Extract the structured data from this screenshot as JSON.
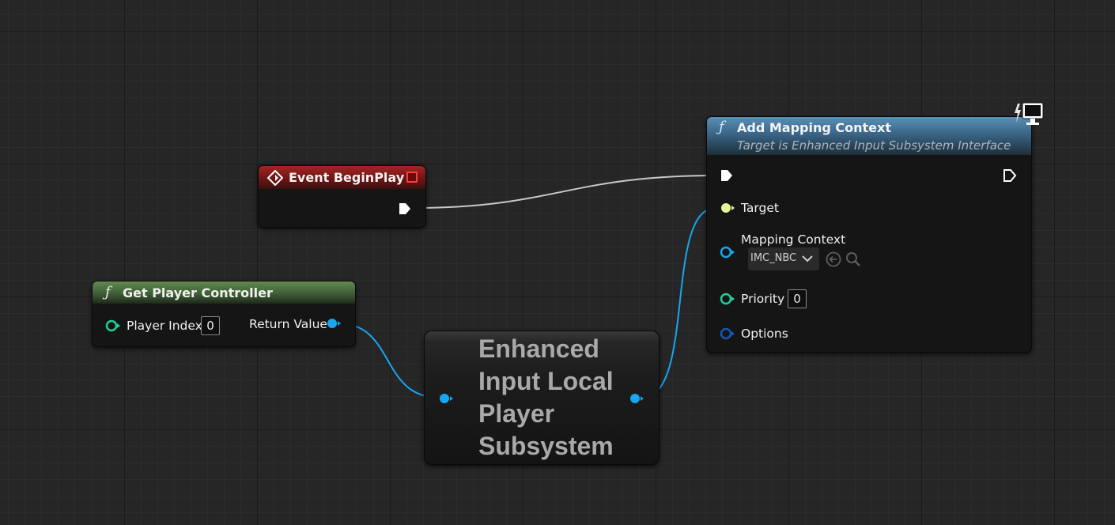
{
  "event_node": {
    "title": "Event BeginPlay"
  },
  "get_player_controller": {
    "title": "Get Player Controller",
    "player_index_label": "Player Index",
    "player_index_value": "0",
    "return_value_label": "Return Value"
  },
  "subsystem_node": {
    "title_line1": "Enhanced",
    "title_line2": "Input Local",
    "title_line3": "Player",
    "title_line4": "Subsystem"
  },
  "add_mapping_context": {
    "title": "Add Mapping Context",
    "subtitle": "Target is Enhanced Input Subsystem Interface",
    "target_label": "Target",
    "mapping_context_label": "Mapping Context",
    "mapping_context_value": "IMC_NBC",
    "priority_label": "Priority",
    "priority_value": "0",
    "options_label": "Options"
  },
  "icons": {
    "function_glyph": "ƒ",
    "event": "event-diamond-icon",
    "delegate": "delegate-square-icon",
    "client_server": "lightning-monitor-icon",
    "browse": "browse-arrow-icon",
    "search": "search-icon",
    "dropdown": "chevron-down-icon"
  },
  "colors": {
    "event_header": "#8a1c1c",
    "function_header_green": "#4b6b43",
    "function_header_blue": "#3f6a8c",
    "object_pin": "#18a6f0",
    "integer_pin": "#1ecf9b",
    "target_pin": "#e6f59a",
    "struct_pin": "#1158b8",
    "exec_wire": "#c8c8c8"
  }
}
